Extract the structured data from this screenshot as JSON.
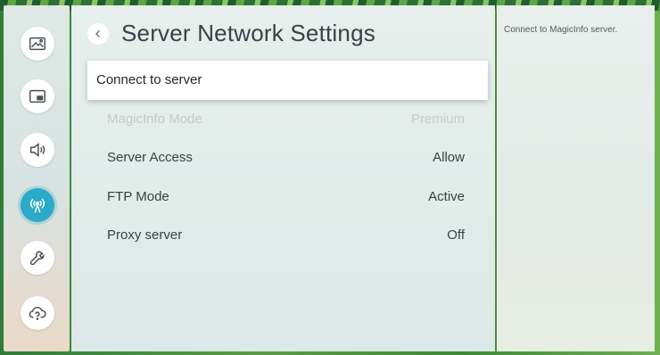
{
  "header": {
    "title": "Server Network Settings"
  },
  "rail": {
    "items": [
      {
        "icon": "picture-icon"
      },
      {
        "icon": "pip-icon"
      },
      {
        "icon": "sound-icon"
      },
      {
        "icon": "network-icon",
        "active": true
      },
      {
        "icon": "wrench-icon"
      },
      {
        "icon": "support-icon"
      }
    ],
    "active_color": "#2ba9c9"
  },
  "menu": {
    "connect": {
      "label": "Connect to server"
    },
    "magicinfo": {
      "label": "MagicInfo Mode",
      "value": "Premium"
    },
    "server_access": {
      "label": "Server Access",
      "value": "Allow"
    },
    "ftp_mode": {
      "label": "FTP Mode",
      "value": "Active"
    },
    "proxy": {
      "label": "Proxy server",
      "value": "Off"
    }
  },
  "description": {
    "text": "Connect to MagicInfo server."
  }
}
